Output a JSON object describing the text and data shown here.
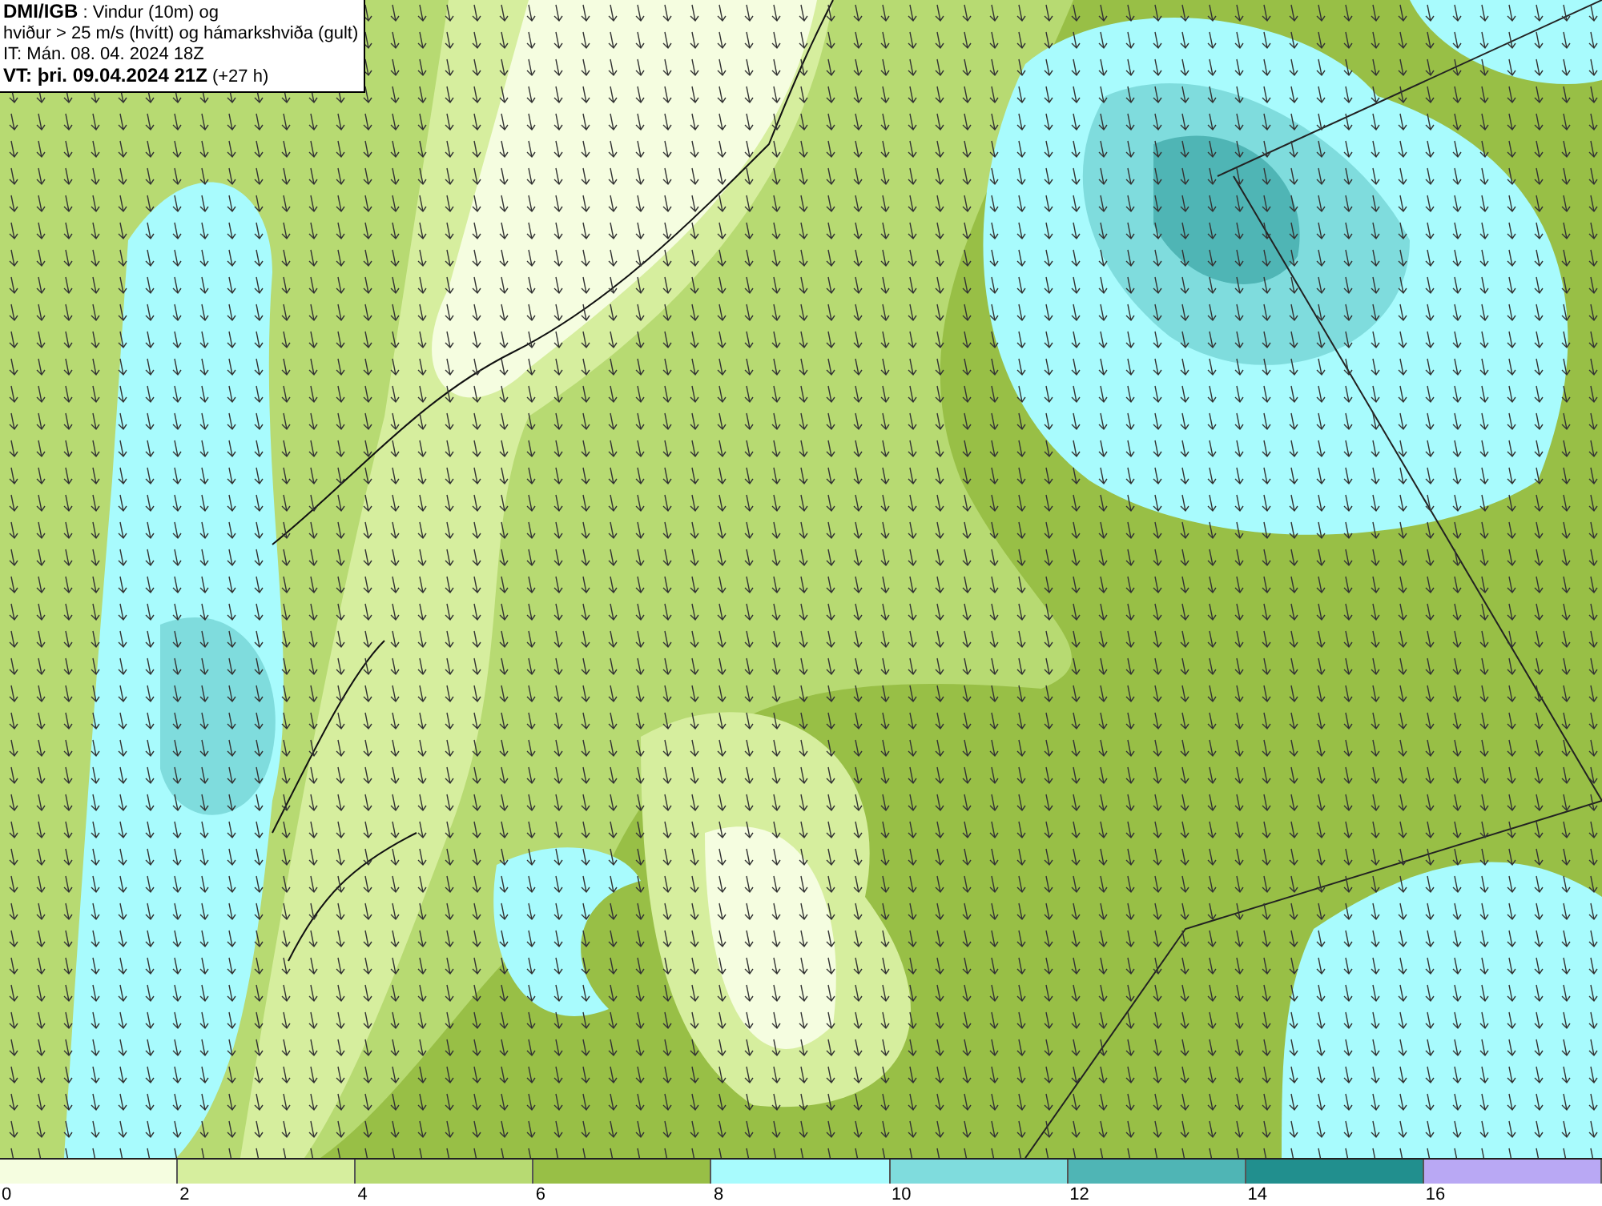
{
  "header": {
    "lines": [
      "**DMI/IGB** : Vindur (10m) og",
      "hviður > 25 m/s (hvítt) og hámarkshviða (gult)",
      "IT: Mán. 08. 04. 2024 18Z",
      "**VT: þri. 09.04.2024 21Z** (+27 h)"
    ]
  },
  "legend": {
    "segments": [
      {
        "color": "#f5fde0"
      },
      {
        "color": "#d6ee9e"
      },
      {
        "color": "#b7da72"
      },
      {
        "color": "#98bf46"
      },
      {
        "color": "#a8fbfd"
      },
      {
        "color": "#7fdcdd"
      },
      {
        "color": "#4fb5b5"
      },
      {
        "color": "#218f8e"
      },
      {
        "color": "#b9a8f4"
      }
    ],
    "ticks": [
      "0",
      "2",
      "4",
      "6",
      "8",
      "10",
      "12",
      "14",
      "16"
    ]
  }
}
